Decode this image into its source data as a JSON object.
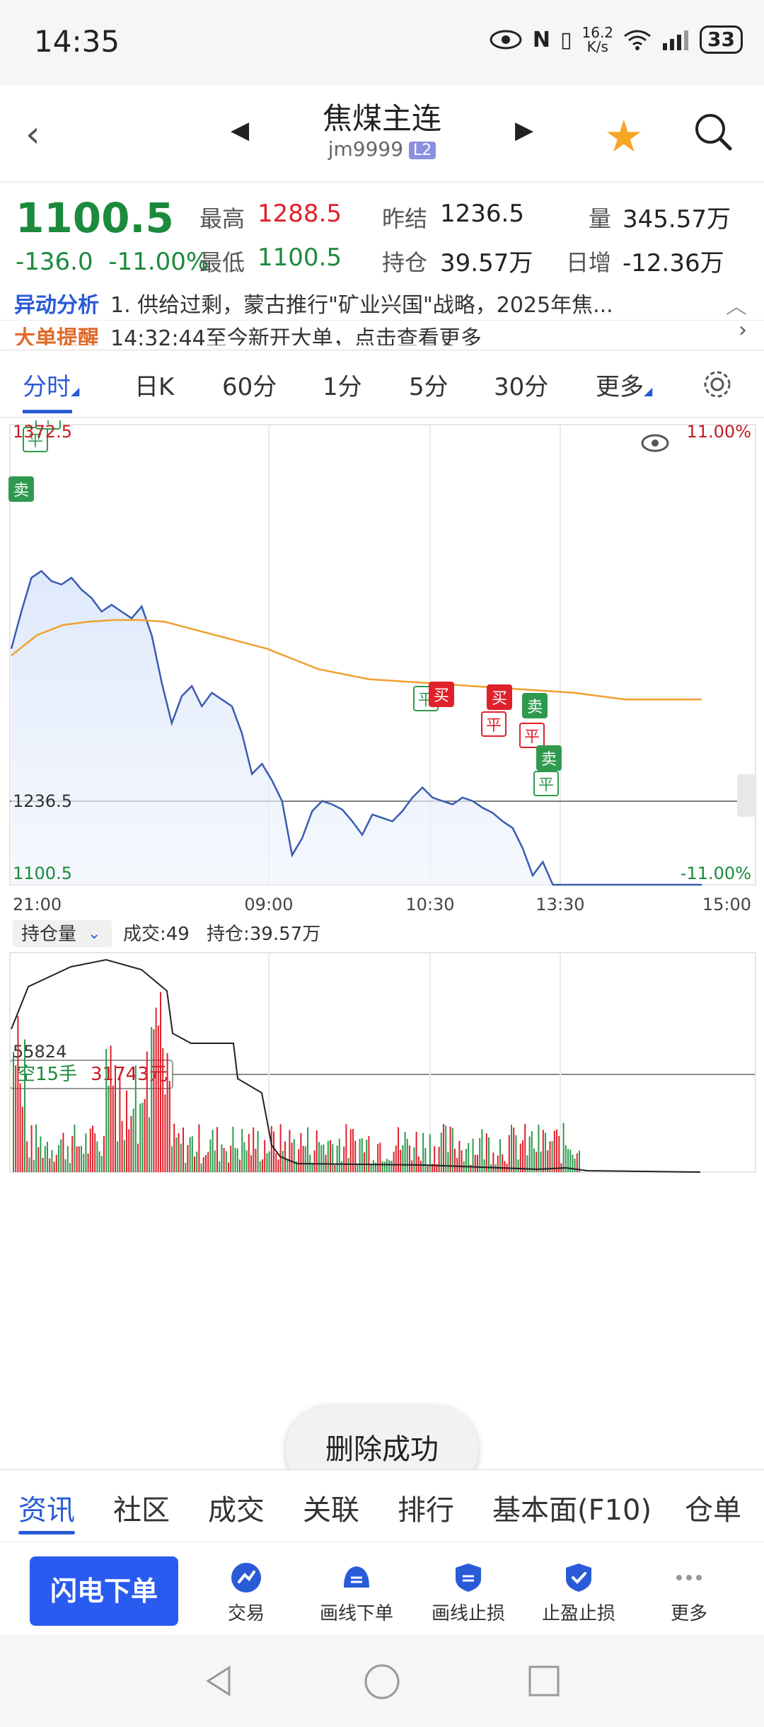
{
  "status_bar": {
    "time": "14:35",
    "net_speed_top": "16.2",
    "net_speed_unit": "K/s",
    "battery": "33"
  },
  "header": {
    "title": "焦煤主连",
    "code": "jm9999",
    "level_badge": "L2"
  },
  "quote": {
    "price": "1100.5",
    "change": "-136.0",
    "change_pct": "-11.00%",
    "high_label": "最高",
    "high_value": "1288.5",
    "low_label": "最低",
    "low_value": "1100.5",
    "prev_settle_label": "昨结",
    "prev_settle_value": "1236.5",
    "open_interest_label": "持仓",
    "open_interest_value": "39.57万",
    "volume_label": "量",
    "volume_value": "345.57万",
    "daily_change_label": "日增",
    "daily_change_value": "-12.36万"
  },
  "news": {
    "tag1": "异动分析",
    "text1": "1. 供给过剩，蒙古推行\"矿业兴国\"战略，2025年焦...",
    "tag2": "大单提醒",
    "text2": "14:32:44至今新开大单，点击查看更多"
  },
  "period_tabs": [
    "分时",
    "日K",
    "60分",
    "1分",
    "5分",
    "30分",
    "更多"
  ],
  "chart": {
    "top_price": "1372.5",
    "top_pct": "11.00%",
    "ref_price": "1236.5",
    "bottom_price": "1100.5",
    "bottom_pct": "-11.00%",
    "time_labels": [
      "21:00",
      "09:00",
      "10:30",
      "13:30",
      "15:00"
    ],
    "position_label": "空15手",
    "position_value": "31743元",
    "sub_selector": "持仓量",
    "sub_info_volume": "成交:49",
    "sub_info_oi": "持仓:39.57万",
    "sub_ref_value": "55824",
    "markers": {
      "sell": "卖",
      "buy": "买",
      "close": "平"
    }
  },
  "chart_data": {
    "type": "line",
    "title": "",
    "xlabel": "",
    "ylabel": "",
    "ylim": [
      1100.5,
      1372.5
    ],
    "x_ticks": [
      "21:00",
      "09:00",
      "10:30",
      "13:30",
      "15:00"
    ],
    "series": [
      {
        "values": [
          1240,
          1262,
          1282,
          1286,
          1280,
          1278,
          1282,
          1275,
          1270,
          1262,
          1266,
          1262,
          1258,
          1265,
          1248,
          1220,
          1196,
          1212,
          1218,
          1206,
          1214,
          1210,
          1206,
          1190,
          1166,
          1172,
          1162,
          1150,
          1118,
          1128,
          1144,
          1150,
          1148,
          1145,
          1138,
          1130,
          1142,
          1140,
          1138,
          1144,
          1152,
          1158,
          1152,
          1150,
          1148,
          1152,
          1150,
          1146,
          1143,
          1138,
          1134,
          1122,
          1106,
          1114,
          1100.5,
          1100.5,
          1100.5,
          1100.5
        ]
      },
      {
        "values": [
          1236,
          1248,
          1254,
          1256,
          1257,
          1257,
          1256,
          1252,
          1248,
          1244,
          1240,
          1234,
          1228,
          1225,
          1222,
          1221,
          1220,
          1219,
          1218,
          1217,
          1216,
          1215,
          1214,
          1212,
          1210,
          1210,
          1210,
          1210
        ]
      }
    ]
  },
  "bottom_tabs": [
    "资讯",
    "社区",
    "成交",
    "关联",
    "排行",
    "基本面(F10)",
    "仓单"
  ],
  "actions": {
    "flash_order": "闪电下单",
    "trade": "交易",
    "draw_order": "画线下单",
    "draw_stoploss": "画线止损",
    "tp_sl": "止盈止损",
    "more": "更多"
  },
  "toast": "删除成功",
  "colors": {
    "down": "#1b8a3c",
    "up": "#e0202a",
    "accent": "#2a5bd7",
    "price_line": "#3a5bb0",
    "avg_line": "#f0a030"
  }
}
